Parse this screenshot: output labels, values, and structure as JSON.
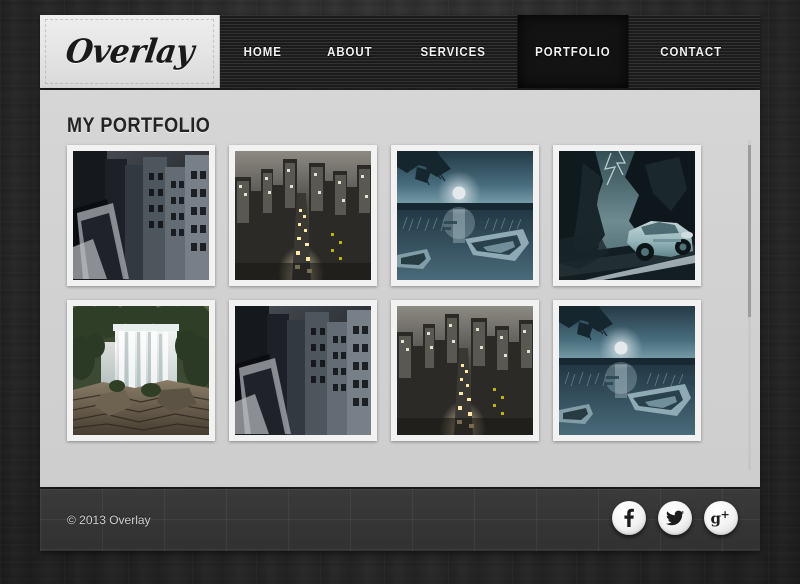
{
  "site": {
    "logo_text": "Overlay",
    "background_color": "#2e2e2e"
  },
  "nav": {
    "items": [
      {
        "label": "HOME",
        "active": false
      },
      {
        "label": "ABOUT",
        "active": false
      },
      {
        "label": "SERVICES",
        "active": false
      },
      {
        "label": "PORTFOLIO",
        "active": true
      },
      {
        "label": "CONTACT",
        "active": false
      }
    ],
    "active_item": "PORTFOLIO",
    "active_bg": "#131313",
    "bar_bg": "#262626",
    "text_color": "#f2f2f2"
  },
  "content": {
    "page_title": "MY PORTFOLIO",
    "panel_bg": "#d2d2d2",
    "title_color": "#232323"
  },
  "gallery": {
    "columns": 4,
    "rows": 2,
    "count": 8,
    "items": [
      {
        "alt": "Black and white apartment buildings seen from a rooftop",
        "theme": "city-bw"
      },
      {
        "alt": "Night city skyline with illuminated avenue",
        "theme": "city-night"
      },
      {
        "alt": "Moonlit lake with wooden rowboats",
        "theme": "moon-lake"
      },
      {
        "alt": "Sports car on mountain road under a stormy sky",
        "theme": "storm-car"
      },
      {
        "alt": "Waterfall over rocks surrounded by green forest",
        "theme": "waterfall"
      },
      {
        "alt": "Black and white apartment buildings seen from a rooftop",
        "theme": "city-bw"
      },
      {
        "alt": "Night city skyline with illuminated avenue",
        "theme": "city-night"
      },
      {
        "alt": "Moonlit lake with wooden rowboats",
        "theme": "moon-lake"
      }
    ]
  },
  "scrollbar": {
    "orientation": "vertical",
    "thumb_color": "#9c9c9c"
  },
  "footer": {
    "copyright": "© 2013 Overlay",
    "bg_color": "#333333",
    "text_color": "#cfcfcf",
    "social": [
      {
        "name": "facebook",
        "glyph": "f",
        "icon": "facebook-icon"
      },
      {
        "name": "twitter",
        "glyph": "",
        "icon": "twitter-icon"
      },
      {
        "name": "googleplus",
        "glyph": "g+",
        "icon": "google-plus-icon"
      }
    ]
  }
}
